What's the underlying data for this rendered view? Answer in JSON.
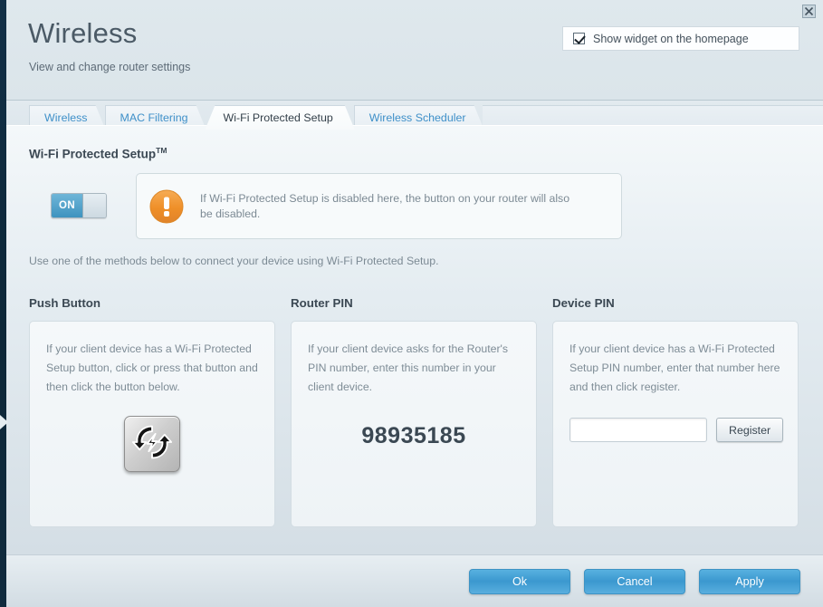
{
  "window": {
    "close_icon": "close-icon"
  },
  "header": {
    "title": "Wireless",
    "subtitle": "View and change router settings",
    "widget_checkbox_label": "Show widget on the homepage",
    "widget_checkbox_checked": "true"
  },
  "tabs": [
    {
      "label": "Wireless",
      "active": "false"
    },
    {
      "label": "MAC Filtering",
      "active": "false"
    },
    {
      "label": "Wi-Fi Protected Setup",
      "active": "true"
    },
    {
      "label": "Wireless Scheduler",
      "active": "false"
    }
  ],
  "main": {
    "section_title": "Wi-Fi Protected Setup",
    "section_title_sup": "TM",
    "toggle": {
      "state_label": "ON",
      "state": "on"
    },
    "warning": {
      "icon": "warning-exclamation-icon",
      "text": "If Wi-Fi Protected Setup is disabled here, the button on your router will also be disabled."
    },
    "methods_note": "Use one of the methods below to connect your device using Wi-Fi Protected Setup.",
    "cards": [
      {
        "heading": "Push Button",
        "text": "If your client device has a Wi-Fi Protected Setup button, click or press that button and then click the button below.",
        "button_icon": "wps-push-button-icon"
      },
      {
        "heading": "Router PIN",
        "text": "If your client device asks for the Router's PIN number, enter this number in your client device.",
        "pin": "98935185"
      },
      {
        "heading": "Device PIN",
        "text": "If your client device has a Wi-Fi Protected Setup PIN number, enter that number here and then click register.",
        "input_value": "",
        "input_placeholder": "",
        "register_label": "Register"
      }
    ]
  },
  "footer": {
    "ok_label": "Ok",
    "cancel_label": "Cancel",
    "apply_label": "Apply"
  },
  "colors": {
    "accent_blue": "#3f90c9",
    "button_blue": "#3b98cf",
    "warning_orange": "#f0922e",
    "rail_dark": "#102b3e"
  }
}
